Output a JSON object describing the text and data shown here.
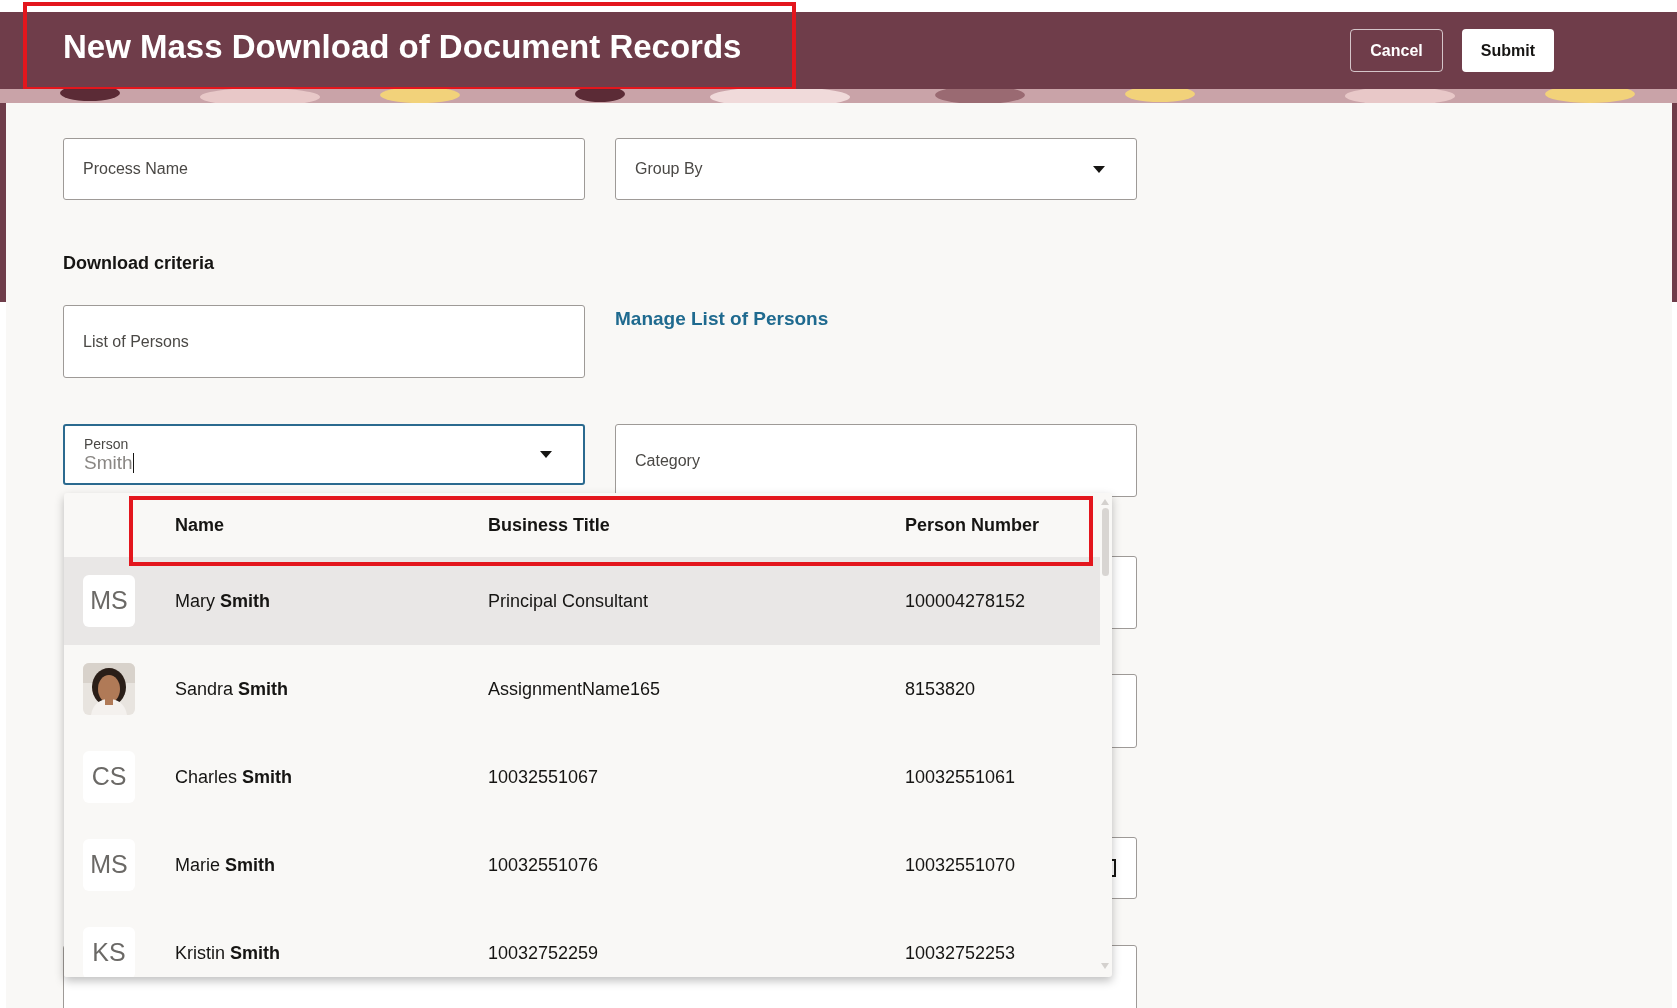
{
  "header": {
    "title": "New Mass Download of Document Records",
    "buttons": [
      {
        "label": "Cancel",
        "kind": "secondary"
      },
      {
        "label": "Submit",
        "kind": "primary"
      }
    ]
  },
  "form": {
    "process_name": {
      "placeholder": "Process Name"
    },
    "group_by": {
      "placeholder": "Group By"
    },
    "section_title": "Download criteria",
    "list_of_persons": {
      "placeholder": "List of Persons"
    },
    "manage_link": "Manage List of Persons",
    "person": {
      "label": "Person",
      "value": "Smith",
      "focused": true
    },
    "category": {
      "placeholder": "Category"
    }
  },
  "person_dropdown": {
    "columns": [
      "Name",
      "Business Title",
      "Person Number"
    ],
    "rows": [
      {
        "kind": "initials",
        "initials": "MS",
        "name": "Mary **Smith**",
        "business_title": "Principal Consultant",
        "person_number": "100004278152",
        "selected": true
      },
      {
        "kind": "picture",
        "name": "Sandra **Smith**",
        "business_title": "AssignmentName165",
        "person_number": "8153820",
        "selected": false
      },
      {
        "kind": "initials",
        "initials": "CS",
        "name": "Charles **Smith**",
        "business_title": "10032551067",
        "person_number": "10032551061",
        "selected": false
      },
      {
        "kind": "initials",
        "initials": "MS",
        "name": "Marie **Smith**",
        "business_title": "10032551076",
        "person_number": "10032551070",
        "selected": false
      },
      {
        "kind": "initials",
        "initials": "KS",
        "name": "Kristin **Smith**",
        "business_title": "10032752259",
        "person_number": "10032752253",
        "selected": false
      }
    ]
  }
}
